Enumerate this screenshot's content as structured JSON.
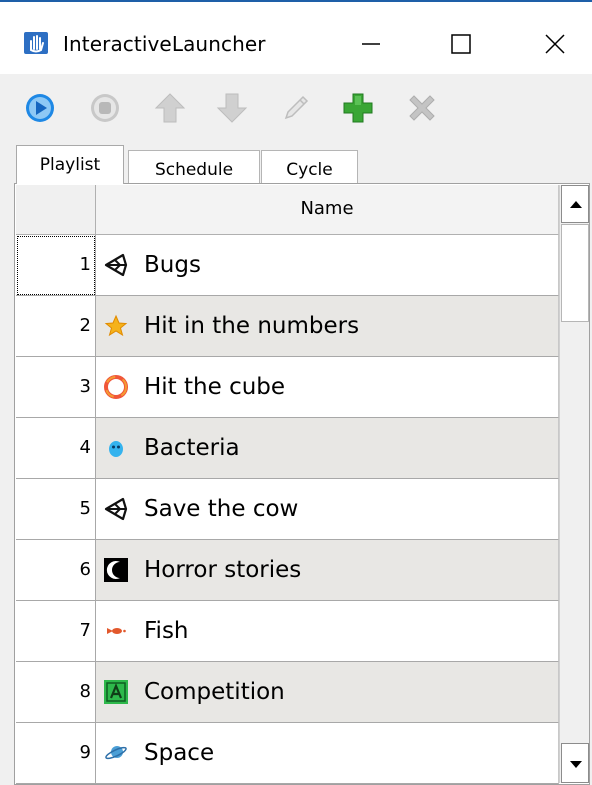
{
  "window": {
    "title": "InteractiveLauncher",
    "icon": "app-hand-icon",
    "controls": [
      "minimize-icon",
      "maximize-icon",
      "close-icon"
    ]
  },
  "toolbar": {
    "buttons": [
      {
        "name": "play",
        "icon": "play-icon",
        "color": "#1e88e5",
        "enabled": true
      },
      {
        "name": "stop",
        "icon": "stop-icon",
        "color": "#bdbdbd",
        "enabled": false
      },
      {
        "name": "move-up",
        "icon": "arrow-up-icon",
        "color": "#c8c8c8",
        "enabled": false
      },
      {
        "name": "move-down",
        "icon": "arrow-down-icon",
        "color": "#c8c8c8",
        "enabled": false
      },
      {
        "name": "edit",
        "icon": "pencil-icon",
        "color": "#c8c8c8",
        "enabled": false
      },
      {
        "name": "add",
        "icon": "plus-icon",
        "color": "#2e9e2e",
        "enabled": true
      },
      {
        "name": "delete",
        "icon": "x-icon",
        "color": "#bdbdbd",
        "enabled": false
      }
    ]
  },
  "tabs": [
    {
      "label": "Playlist",
      "active": true
    },
    {
      "label": "Schedule",
      "active": false
    },
    {
      "label": "Cycle",
      "active": false
    }
  ],
  "table": {
    "columns": [
      "Name"
    ],
    "rows": [
      {
        "num": "1",
        "name": "Bugs",
        "icon": "unity-icon"
      },
      {
        "num": "2",
        "name": "Hit in the numbers",
        "icon": "star-icon"
      },
      {
        "num": "3",
        "name": "Hit the cube",
        "icon": "ring-icon"
      },
      {
        "num": "4",
        "name": "Bacteria",
        "icon": "bacteria-icon"
      },
      {
        "num": "5",
        "name": "Save the cow",
        "icon": "unity-icon"
      },
      {
        "num": "6",
        "name": "Horror stories",
        "icon": "moon-icon"
      },
      {
        "num": "7",
        "name": "Fish",
        "icon": "fish-icon"
      },
      {
        "num": "8",
        "name": "Competition",
        "icon": "letter-a-icon"
      },
      {
        "num": "9",
        "name": "Space",
        "icon": "planet-icon"
      }
    ]
  }
}
